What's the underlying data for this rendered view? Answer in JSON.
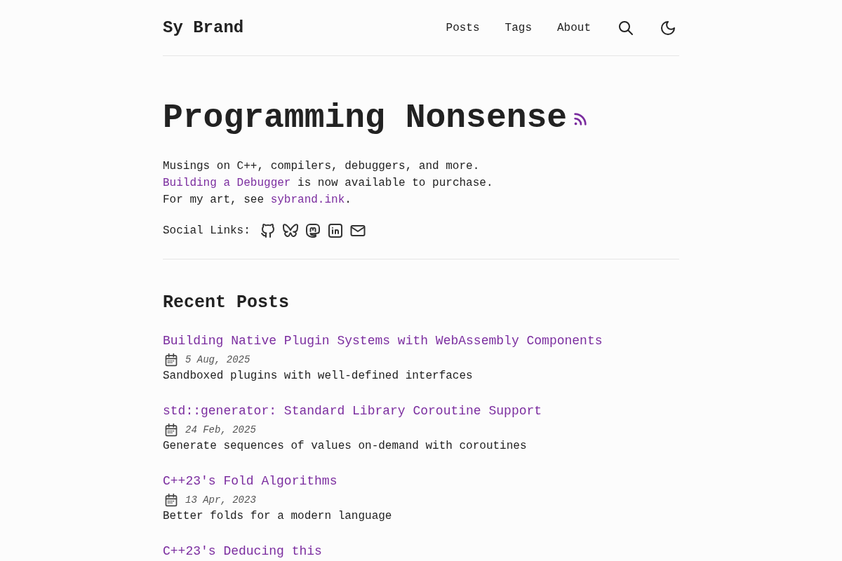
{
  "header": {
    "brand": "Sy Brand",
    "nav": [
      {
        "label": "Posts"
      },
      {
        "label": "Tags"
      },
      {
        "label": "About"
      }
    ]
  },
  "intro": {
    "title": "Programming Nonsense",
    "lines": [
      [
        {
          "kind": "text",
          "text": "Musings on C++, compilers, debuggers, and more."
        }
      ],
      [
        {
          "kind": "link",
          "text": "Building a Debugger"
        },
        {
          "kind": "text",
          "text": " is now available to purchase."
        }
      ],
      [
        {
          "kind": "text",
          "text": "For my art, see "
        },
        {
          "kind": "link",
          "text": "sybrand.ink"
        },
        {
          "kind": "text",
          "text": "."
        }
      ]
    ]
  },
  "social": {
    "label": "Social Links:",
    "links": [
      {
        "kind": "github"
      },
      {
        "kind": "bluesky"
      },
      {
        "kind": "mastodon"
      },
      {
        "kind": "linkedin"
      },
      {
        "kind": "email"
      }
    ]
  },
  "recent": {
    "heading": "Recent Posts",
    "posts": [
      {
        "title": "Building Native Plugin Systems with WebAssembly Components",
        "date": "5 Aug, 2025",
        "description": "Sandboxed plugins with well-defined interfaces"
      },
      {
        "title": "std::generator: Standard Library Coroutine Support",
        "date": "24 Feb, 2025",
        "description": "Generate sequences of values on-demand with coroutines"
      },
      {
        "title": "C++23's Fold Algorithms",
        "date": "13 Apr, 2023",
        "description": "Better folds for a modern language"
      },
      {
        "title": "C++23's Deducing this"
      }
    ]
  }
}
